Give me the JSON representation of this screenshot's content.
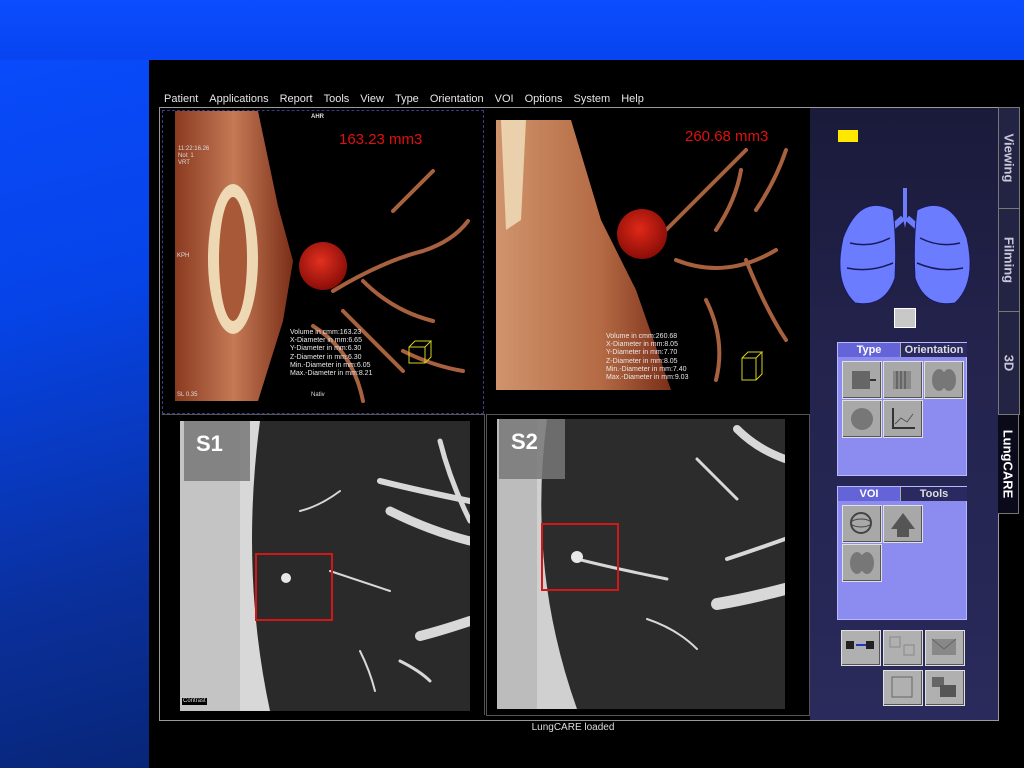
{
  "menu": {
    "items": [
      "Patient",
      "Applications",
      "Report",
      "Tools",
      "View",
      "Type",
      "Orientation",
      "VOI",
      "Options",
      "System",
      "Help"
    ]
  },
  "viewport1": {
    "volume_label": "163.23 mm3",
    "orientation_top": "AHR",
    "orientation_left": "KPH",
    "info_lines": [
      "11:22:16.26",
      "Nol: 1",
      "VRT"
    ],
    "footer_left": "SL 0.35",
    "footer_center": "Nativ",
    "measurements": [
      "Volume in cmm:163.23",
      "X-Diameter in mm:6.65",
      "Y-Diameter in mm:6.30",
      "Z-Diameter in mm:6.30",
      "Min.-Diameter in mm:6.05",
      "Max.-Diameter in mm:8.21"
    ]
  },
  "viewport2": {
    "volume_label": "260.68 mm3",
    "measurements": [
      "Volume in cmm:260.68",
      "X-Diameter in mm:8.05",
      "Y-Diameter in mm:7.70",
      "Z-Diameter in mm:8.05",
      "Min.-Diameter in mm:7.40",
      "Max.-Diameter in mm:9.03"
    ]
  },
  "viewport3": {
    "series_tag": "S1",
    "corner_label": "Contrast"
  },
  "viewport4": {
    "series_tag": "S2"
  },
  "side_tabs": [
    "Viewing",
    "Filming",
    "3D",
    "LungCARE"
  ],
  "active_side_tab": "LungCARE",
  "type_panel": {
    "tabs": [
      "Type",
      "Orientation"
    ]
  },
  "voi_panel": {
    "tabs": [
      "VOI",
      "Tools"
    ]
  },
  "status": {
    "text": "LungCARE loaded"
  },
  "colors": {
    "slide_blue": "#0a4cff",
    "panel_purple": "#8c8cf0",
    "volume_red": "#e01010",
    "lung_blue": "#6b7cff"
  }
}
